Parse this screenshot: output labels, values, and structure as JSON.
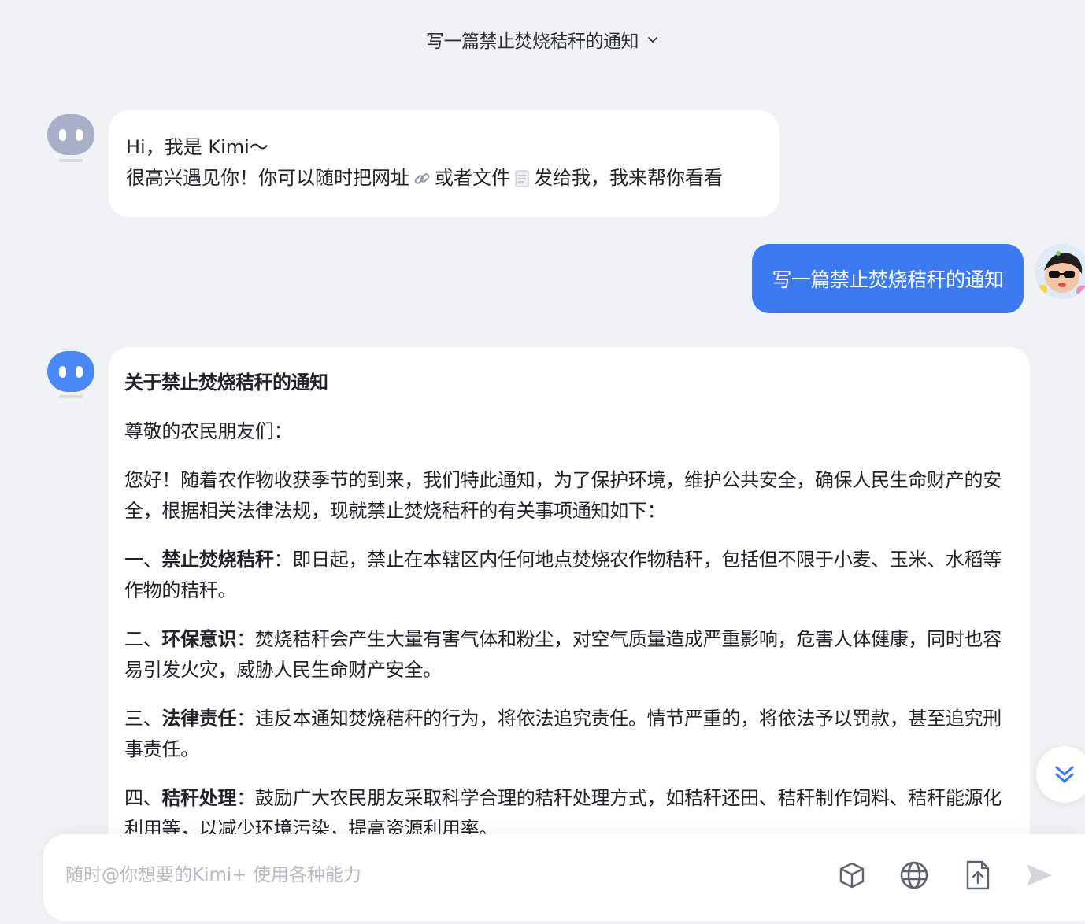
{
  "header": {
    "title": "写一篇禁止焚烧秸秆的通知"
  },
  "greeting": {
    "line1": "Hi，我是 Kimi～",
    "line2_a": "很高兴遇见你！你可以随时把网址",
    "line2_b": "或者文件",
    "line2_c": "发给我，我来帮你看看"
  },
  "user_message": {
    "text": "写一篇禁止焚烧秸秆的通知"
  },
  "reply": {
    "heading": "关于禁止焚烧秸秆的通知",
    "salutation": "尊敬的农民朋友们：",
    "intro": "您好！随着农作物收获季节的到来，我们特此通知，为了保护环境，维护公共安全，确保人民生命财产的安全，根据相关法律法规，现就禁止焚烧秸秆的有关事项通知如下：",
    "items": [
      {
        "num": "一、",
        "title": "禁止焚烧秸秆",
        "text": "：即日起，禁止在本辖区内任何地点焚烧农作物秸秆，包括但不限于小麦、玉米、水稻等作物的秸秆。"
      },
      {
        "num": "二、",
        "title": "环保意识",
        "text": "：焚烧秸秆会产生大量有害气体和粉尘，对空气质量造成严重影响，危害人体健康，同时也容易引发火灾，威胁人民生命财产安全。"
      },
      {
        "num": "三、",
        "title": "法律责任",
        "text": "：违反本通知焚烧秸秆的行为，将依法追究责任。情节严重的，将依法予以罚款，甚至追究刑事责任。"
      },
      {
        "num": "四、",
        "title": "秸秆处理",
        "text": "：鼓励广大农民朋友采取科学合理的秸秆处理方式，如秸秆还田、秸秆制作饲料、秸秆能源化利用等，以减少环境污染，提高资源利用率。"
      }
    ]
  },
  "input": {
    "placeholder": "随时@你想要的Kimi+ 使用各种能力"
  },
  "icons": {
    "title_chevron": "chevron-down-icon",
    "link": "link-icon",
    "file": "document-icon",
    "scroll": "double-chevron-down-icon",
    "cube": "cube-icon",
    "globe": "globe-icon",
    "upload": "file-upload-icon",
    "send": "send-icon"
  },
  "colors": {
    "accent": "#3c7af3",
    "background": "#f1f2f5",
    "bot_avatar_idle": "#a9aec9",
    "bot_avatar_active": "#4a88f5"
  }
}
